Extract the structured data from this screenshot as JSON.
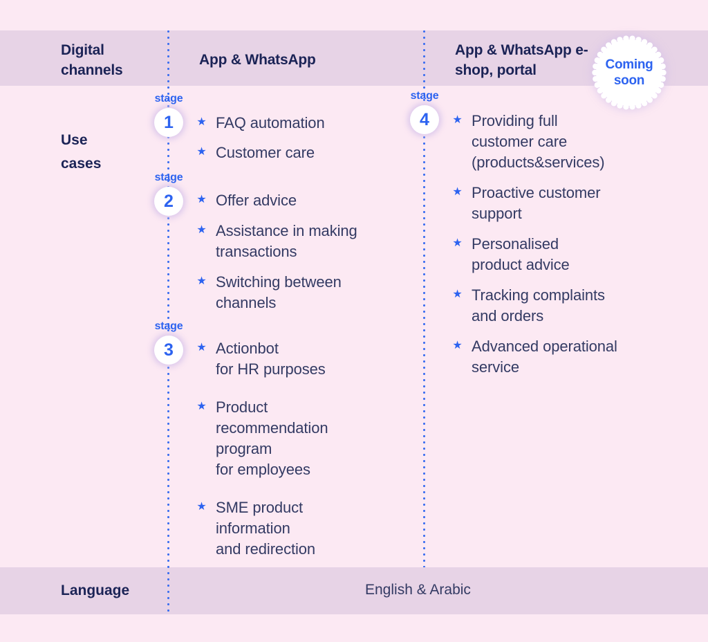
{
  "colors": {
    "page_background": "#fce9f3",
    "band_background": "#e7d3e6",
    "accent_blue": "#2d63f0",
    "heading_navy": "#1b2356",
    "body_navy": "#333a63",
    "badge_fill": "#ffffff"
  },
  "header": {
    "channels_title": "Digital\nchannels",
    "app_title": "App & WhatsApp",
    "eshop_title": "App & WhatsApp\ne-shop, portal",
    "badge": {
      "label": "Coming\nsoon",
      "icon": "starburst-badge"
    }
  },
  "rows": {
    "use_cases_label": "Use\ncases",
    "language_label": "Language",
    "language_value": "English & Arabic"
  },
  "stage_caption": "stage",
  "bullet_icon": "star-bullet-icon",
  "stages": [
    {
      "number": "1",
      "caption": "stage",
      "column": "App & WhatsApp",
      "items": [
        "FAQ automation",
        "Customer care"
      ]
    },
    {
      "number": "2",
      "caption": "stage",
      "column": "App & WhatsApp",
      "items": [
        "Offer advice",
        "Assistance in making\ntransactions",
        "Switching between\nchannels"
      ]
    },
    {
      "number": "3",
      "caption": "stage",
      "column": "App & WhatsApp",
      "items": [
        "Actionbot\nfor HR purposes",
        "Product\nrecommendation\nprogram\nfor employees",
        "SME product\ninformation\nand redirection"
      ]
    },
    {
      "number": "4",
      "caption": "stage",
      "column": "App & WhatsApp e-shop, portal",
      "items": [
        "Providing full\ncustomer care\n(products&services)",
        "Proactive customer\nsupport",
        "Personalised\nproduct advice",
        "Tracking complaints\nand orders",
        "Advanced operational\nservice"
      ]
    }
  ]
}
